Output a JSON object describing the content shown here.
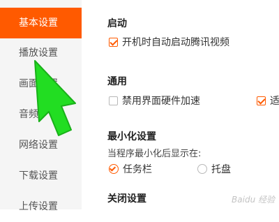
{
  "sidebar": {
    "items": [
      {
        "label": "基本设置",
        "active": true
      },
      {
        "label": "播放设置",
        "active": false
      },
      {
        "label": "画面设置",
        "active": false
      },
      {
        "label": "音频",
        "active": false
      },
      {
        "label": "网络设置",
        "active": false
      },
      {
        "label": "下载设置",
        "active": false
      },
      {
        "label": "上传设置",
        "active": false
      }
    ]
  },
  "main": {
    "startup": {
      "title": "启动",
      "options": [
        {
          "label": "开机时自动启动腾讯视频",
          "checked": true
        }
      ]
    },
    "general": {
      "title": "通用",
      "options": [
        {
          "label": "禁用界面硬件加速",
          "checked": false
        },
        {
          "label": "适",
          "checked": true
        }
      ]
    },
    "minimize": {
      "title": "最小化设置",
      "subtitle": "当程序最小化后显示在:",
      "options": [
        {
          "label": "任务栏",
          "checked": true
        },
        {
          "label": "托盘",
          "checked": false
        }
      ]
    },
    "close": {
      "title": "关闭设置"
    }
  },
  "colors": {
    "accent": "#ff5a00",
    "cursor": "#22dd22"
  },
  "icons": {
    "cursor": "arrow-cursor-icon"
  },
  "watermark": "Baidu 经验"
}
